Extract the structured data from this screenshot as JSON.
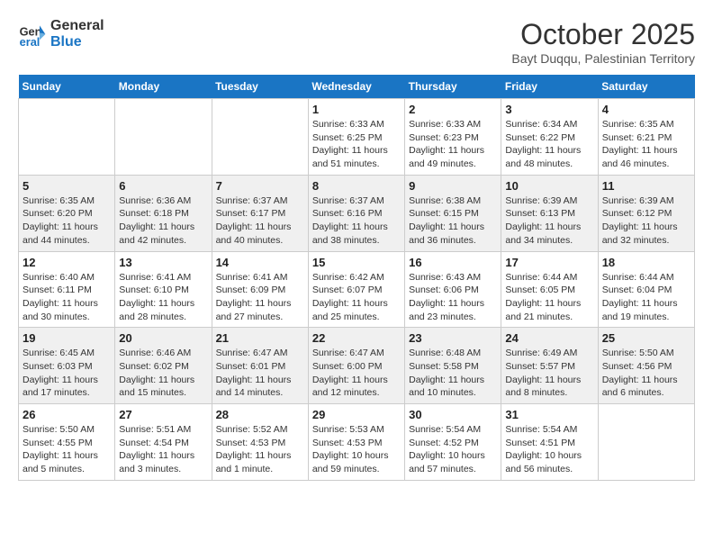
{
  "header": {
    "logo_line1": "General",
    "logo_line2": "Blue",
    "month": "October 2025",
    "location": "Bayt Duqqu, Palestinian Territory"
  },
  "days_of_week": [
    "Sunday",
    "Monday",
    "Tuesday",
    "Wednesday",
    "Thursday",
    "Friday",
    "Saturday"
  ],
  "weeks": [
    [
      {
        "day": "",
        "info": ""
      },
      {
        "day": "",
        "info": ""
      },
      {
        "day": "",
        "info": ""
      },
      {
        "day": "1",
        "info": "Sunrise: 6:33 AM\nSunset: 6:25 PM\nDaylight: 11 hours\nand 51 minutes."
      },
      {
        "day": "2",
        "info": "Sunrise: 6:33 AM\nSunset: 6:23 PM\nDaylight: 11 hours\nand 49 minutes."
      },
      {
        "day": "3",
        "info": "Sunrise: 6:34 AM\nSunset: 6:22 PM\nDaylight: 11 hours\nand 48 minutes."
      },
      {
        "day": "4",
        "info": "Sunrise: 6:35 AM\nSunset: 6:21 PM\nDaylight: 11 hours\nand 46 minutes."
      }
    ],
    [
      {
        "day": "5",
        "info": "Sunrise: 6:35 AM\nSunset: 6:20 PM\nDaylight: 11 hours\nand 44 minutes."
      },
      {
        "day": "6",
        "info": "Sunrise: 6:36 AM\nSunset: 6:18 PM\nDaylight: 11 hours\nand 42 minutes."
      },
      {
        "day": "7",
        "info": "Sunrise: 6:37 AM\nSunset: 6:17 PM\nDaylight: 11 hours\nand 40 minutes."
      },
      {
        "day": "8",
        "info": "Sunrise: 6:37 AM\nSunset: 6:16 PM\nDaylight: 11 hours\nand 38 minutes."
      },
      {
        "day": "9",
        "info": "Sunrise: 6:38 AM\nSunset: 6:15 PM\nDaylight: 11 hours\nand 36 minutes."
      },
      {
        "day": "10",
        "info": "Sunrise: 6:39 AM\nSunset: 6:13 PM\nDaylight: 11 hours\nand 34 minutes."
      },
      {
        "day": "11",
        "info": "Sunrise: 6:39 AM\nSunset: 6:12 PM\nDaylight: 11 hours\nand 32 minutes."
      }
    ],
    [
      {
        "day": "12",
        "info": "Sunrise: 6:40 AM\nSunset: 6:11 PM\nDaylight: 11 hours\nand 30 minutes."
      },
      {
        "day": "13",
        "info": "Sunrise: 6:41 AM\nSunset: 6:10 PM\nDaylight: 11 hours\nand 28 minutes."
      },
      {
        "day": "14",
        "info": "Sunrise: 6:41 AM\nSunset: 6:09 PM\nDaylight: 11 hours\nand 27 minutes."
      },
      {
        "day": "15",
        "info": "Sunrise: 6:42 AM\nSunset: 6:07 PM\nDaylight: 11 hours\nand 25 minutes."
      },
      {
        "day": "16",
        "info": "Sunrise: 6:43 AM\nSunset: 6:06 PM\nDaylight: 11 hours\nand 23 minutes."
      },
      {
        "day": "17",
        "info": "Sunrise: 6:44 AM\nSunset: 6:05 PM\nDaylight: 11 hours\nand 21 minutes."
      },
      {
        "day": "18",
        "info": "Sunrise: 6:44 AM\nSunset: 6:04 PM\nDaylight: 11 hours\nand 19 minutes."
      }
    ],
    [
      {
        "day": "19",
        "info": "Sunrise: 6:45 AM\nSunset: 6:03 PM\nDaylight: 11 hours\nand 17 minutes."
      },
      {
        "day": "20",
        "info": "Sunrise: 6:46 AM\nSunset: 6:02 PM\nDaylight: 11 hours\nand 15 minutes."
      },
      {
        "day": "21",
        "info": "Sunrise: 6:47 AM\nSunset: 6:01 PM\nDaylight: 11 hours\nand 14 minutes."
      },
      {
        "day": "22",
        "info": "Sunrise: 6:47 AM\nSunset: 6:00 PM\nDaylight: 11 hours\nand 12 minutes."
      },
      {
        "day": "23",
        "info": "Sunrise: 6:48 AM\nSunset: 5:58 PM\nDaylight: 11 hours\nand 10 minutes."
      },
      {
        "day": "24",
        "info": "Sunrise: 6:49 AM\nSunset: 5:57 PM\nDaylight: 11 hours\nand 8 minutes."
      },
      {
        "day": "25",
        "info": "Sunrise: 5:50 AM\nSunset: 4:56 PM\nDaylight: 11 hours\nand 6 minutes."
      }
    ],
    [
      {
        "day": "26",
        "info": "Sunrise: 5:50 AM\nSunset: 4:55 PM\nDaylight: 11 hours\nand 5 minutes."
      },
      {
        "day": "27",
        "info": "Sunrise: 5:51 AM\nSunset: 4:54 PM\nDaylight: 11 hours\nand 3 minutes."
      },
      {
        "day": "28",
        "info": "Sunrise: 5:52 AM\nSunset: 4:53 PM\nDaylight: 11 hours\nand 1 minute."
      },
      {
        "day": "29",
        "info": "Sunrise: 5:53 AM\nSunset: 4:53 PM\nDaylight: 10 hours\nand 59 minutes."
      },
      {
        "day": "30",
        "info": "Sunrise: 5:54 AM\nSunset: 4:52 PM\nDaylight: 10 hours\nand 57 minutes."
      },
      {
        "day": "31",
        "info": "Sunrise: 5:54 AM\nSunset: 4:51 PM\nDaylight: 10 hours\nand 56 minutes."
      },
      {
        "day": "",
        "info": ""
      }
    ]
  ]
}
